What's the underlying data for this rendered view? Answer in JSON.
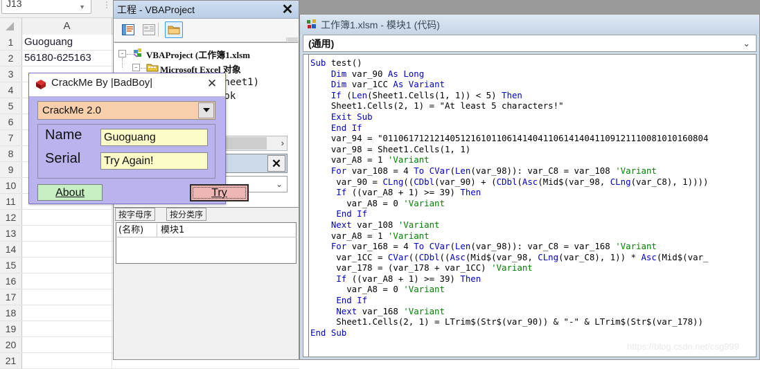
{
  "excel": {
    "namebox_value": "J13",
    "column_header": "A",
    "rows": [
      {
        "num": "1",
        "a": "Guoguang"
      },
      {
        "num": "2",
        "a": "56180-625163"
      },
      {
        "num": "3",
        "a": ""
      },
      {
        "num": "4",
        "a": ""
      },
      {
        "num": "5",
        "a": ""
      },
      {
        "num": "6",
        "a": ""
      },
      {
        "num": "7",
        "a": ""
      },
      {
        "num": "8",
        "a": ""
      },
      {
        "num": "9",
        "a": ""
      },
      {
        "num": "10",
        "a": ""
      },
      {
        "num": "11",
        "a": ""
      },
      {
        "num": "12",
        "a": ""
      },
      {
        "num": "13",
        "a": ""
      },
      {
        "num": "14",
        "a": ""
      },
      {
        "num": "15",
        "a": ""
      },
      {
        "num": "16",
        "a": ""
      },
      {
        "num": "17",
        "a": ""
      },
      {
        "num": "18",
        "a": ""
      },
      {
        "num": "19",
        "a": ""
      },
      {
        "num": "20",
        "a": ""
      },
      {
        "num": "21",
        "a": ""
      }
    ]
  },
  "project_explorer": {
    "title": "工程 - VBAProject",
    "close_label": "✕",
    "toolbar": {
      "view_code_tooltip": "查看代码",
      "view_object_tooltip": "查看对象",
      "toggle_folders_tooltip": "切换文件夹"
    },
    "tree": {
      "root": "VBAProject (工作簿1.xlsm",
      "child1": "Microsoft Excel 对象",
      "child2": "Sheet1)",
      "child3": "ook",
      "expander_open": "-"
    }
  },
  "properties_panel": {
    "tab_alpha": "按字母序",
    "tab_category": "按分类序",
    "rows": [
      {
        "key": "(名称)",
        "value": "模块1"
      }
    ]
  },
  "crackme_dialog": {
    "title": "CrackMe  By |BadBoy|",
    "close_label": "✕",
    "combo_value": "CrackMe 2.0",
    "fields": [
      {
        "label": "Name",
        "value": "Guoguang"
      },
      {
        "label": "Serial",
        "value": "Try Again!"
      }
    ],
    "about_button": "About",
    "try_button": "Try",
    "colors": {
      "dialog_bg": "#b9b3ee",
      "combo_bg": "#f7cfaa",
      "input_bg": "#fbfbc8",
      "about_bg": "#c6f0c3",
      "try_bg": "#efb6b6"
    }
  },
  "code_window": {
    "title": "工作簿1.xlsm - 模块1 (代码)",
    "procedure_dropdown": "(通用)",
    "code_lines": [
      "Sub test()",
      "    Dim var_90 As Long",
      "    Dim var_1CC As Variant",
      "    If (Len(Sheet1.Cells(1, 1)) < 5) Then",
      "    Sheet1.Cells(2, 1) = \"At least 5 characters!\"",
      "    Exit Sub",
      "    End If",
      "    var_94 = \"011061712121405121610110614140411061414041109121110081010160804",
      "    var_98 = Sheet1.Cells(1, 1)",
      "    var_A8 = 1 'Variant",
      "    For var_108 = 4 To CVar(Len(var_98)): var_C8 = var_108 'Variant",
      "     var_90 = CLng((CDbl(var_90) + (CDbl(Asc(Mid$(var_98, CLng(var_C8), 1))))",
      "     If ((var_A8 + 1) >= 39) Then",
      "       var_A8 = 0 'Variant",
      "     End If",
      "    Next var_108 'Variant",
      "    var_A8 = 1 'Variant",
      "    For var_168 = 4 To CVar(Len(var_98)): var_C8 = var_168 'Variant",
      "     var_1CC = CVar((CDbl((Asc(Mid$(var_98, CLng(var_C8), 1)) * Asc(Mid$(var_",
      "     var_178 = (var_178 + var_1CC) 'Variant",
      "     If ((var_A8 + 1) >= 39) Then",
      "       var_A8 = 0 'Variant",
      "     End If",
      "     Next var_168 'Variant",
      "     Sheet1.Cells(2, 1) = LTrim$(Str$(var_90)) & \"-\" & LTrim$(Str$(var_178))",
      "End Sub"
    ]
  },
  "watermark": "https://blog.csdn.net/csg999"
}
